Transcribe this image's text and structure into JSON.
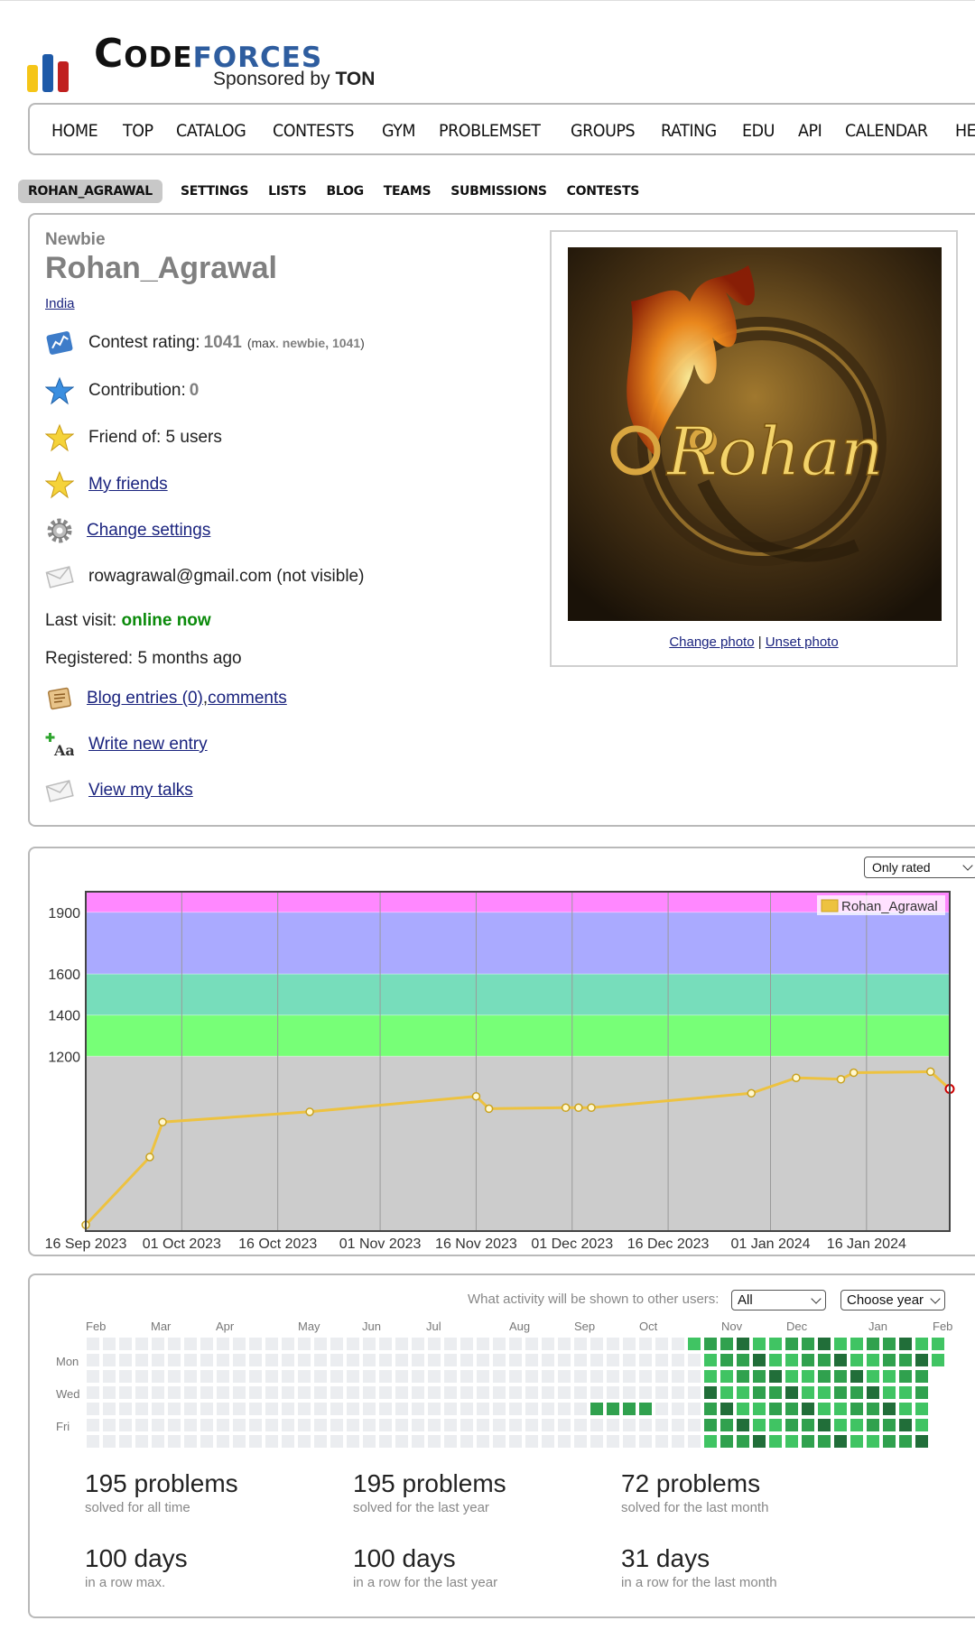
{
  "logo": {
    "word_a": "Code",
    "word_b": "forces",
    "sponsor_prefix": "Sponsored by ",
    "sponsor_name": "TON",
    "bar_colors": [
      "#f5c518",
      "#1e5aa8",
      "#c0201f"
    ]
  },
  "main_menu": [
    "HOME",
    "TOP",
    "CATALOG",
    "CONTESTS",
    "GYM",
    "PROBLEMSET",
    "GROUPS",
    "RATING",
    "EDU",
    "API",
    "CALENDAR",
    "HELP"
  ],
  "second_menu": [
    "ROHAN_AGRAWAL",
    "SETTINGS",
    "LISTS",
    "BLOG",
    "TEAMS",
    "SUBMISSIONS",
    "CONTESTS"
  ],
  "profile": {
    "rank": "Newbie",
    "handle": "Rohan_Agrawal",
    "country": "India",
    "contest_rating_label": "Contest rating: ",
    "contest_rating": "1041",
    "max_prefix": "(max. ",
    "max_rank": "newbie, 1041",
    "max_suffix": ")",
    "contribution_label": "Contribution: ",
    "contribution": "0",
    "friend_of": "Friend of: 5 users",
    "my_friends": "My friends",
    "change_settings": "Change settings",
    "email": "rowagrawal@gmail.com (not visible)",
    "last_visit_label": "Last visit: ",
    "last_visit": "online now",
    "registered": "Registered: 5 months ago",
    "blog_entries": "Blog entries (0)",
    "comma": ", ",
    "comments": "comments",
    "write_entry": "Write new entry",
    "view_talks": "View my talks",
    "change_photo": "Change photo",
    "separator": " | ",
    "unset_photo": "Unset photo",
    "avatar_text": "Rohan"
  },
  "rating_filter": "Only rated",
  "chart_data": {
    "type": "line",
    "series": [
      {
        "name": "Rohan_Agrawal",
        "color": "#edc240",
        "x": [
          "2023-09-16",
          "2023-09-26",
          "2023-09-28",
          "2023-10-21",
          "2023-11-16",
          "2023-11-18",
          "2023-11-30",
          "2023-12-02",
          "2023-12-04",
          "2023-12-29",
          "2024-01-05",
          "2024-01-12",
          "2024-01-14",
          "2024-01-26",
          "2024-01-29"
        ],
        "y": [
          380,
          710,
          880,
          930,
          1005,
          945,
          950,
          950,
          950,
          1020,
          1095,
          1088,
          1120,
          1125,
          1041
        ]
      }
    ],
    "x_ticks": [
      "16 Sep 2023",
      "01 Oct 2023",
      "16 Oct 2023",
      "01 Nov 2023",
      "16 Nov 2023",
      "01 Dec 2023",
      "16 Dec 2023",
      "01 Jan 2024",
      "16 Jan 2024"
    ],
    "y_ticks": [
      1200,
      1400,
      1600,
      1900
    ],
    "ylim": [
      350,
      2000
    ],
    "bands": [
      {
        "from": 350,
        "to": 1200,
        "color": "#cccccc"
      },
      {
        "from": 1200,
        "to": 1400,
        "color": "#77ff77"
      },
      {
        "from": 1400,
        "to": 1600,
        "color": "#77ddbb"
      },
      {
        "from": 1600,
        "to": 1900,
        "color": "#aaaaff"
      },
      {
        "from": 1900,
        "to": 2000,
        "color": "#ff88ff"
      }
    ],
    "grid": true,
    "legend": "top-right"
  },
  "activity": {
    "prompt": "What activity will be shown to other users:",
    "filter": "All",
    "year_select": "Choose year",
    "months": [
      "Feb",
      "Mar",
      "Apr",
      "May",
      "Jun",
      "Jul",
      "Aug",
      "Sep",
      "Oct",
      "Nov",
      "Dec",
      "Jan",
      "Feb"
    ],
    "days": [
      "Mon",
      "Wed",
      "Fri"
    ],
    "stats": [
      {
        "value": "195 problems",
        "desc": "solved for all time"
      },
      {
        "value": "195 problems",
        "desc": "solved for the last year"
      },
      {
        "value": "72 problems",
        "desc": "solved for the last month"
      },
      {
        "value": "100 days",
        "desc": "in a row max."
      },
      {
        "value": "100 days",
        "desc": "in a row for the last year"
      },
      {
        "value": "31 days",
        "desc": "in a row for the last month"
      }
    ]
  }
}
